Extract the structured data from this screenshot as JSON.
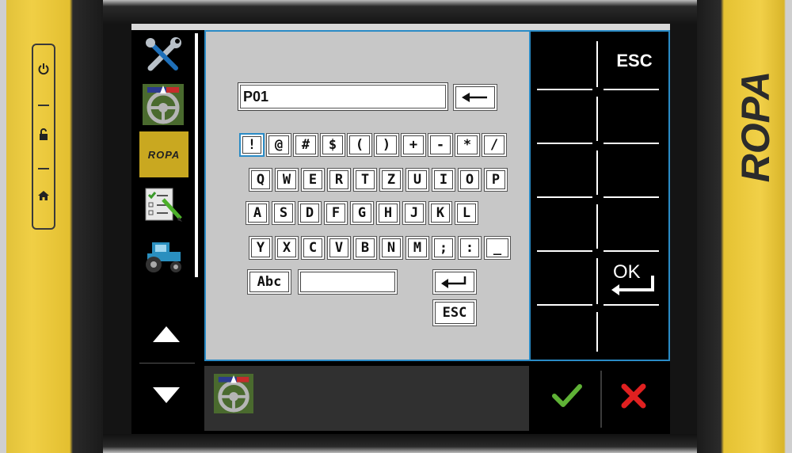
{
  "device": {
    "brand": "ROPA",
    "hw_buttons": [
      "power-icon",
      "unlock-icon",
      "home-icon"
    ]
  },
  "sidebar": {
    "items": [
      {
        "name": "tools-icon"
      },
      {
        "name": "steering-wheel-icon"
      },
      {
        "name": "ropa-logo-tile",
        "label": "ROPA"
      },
      {
        "name": "checklist-icon"
      },
      {
        "name": "tractor-icon"
      }
    ],
    "nav_up": "triangle-up-icon",
    "nav_down": "triangle-down-icon"
  },
  "input": {
    "value": "P01",
    "backspace_icon": "backspace-arrow-icon"
  },
  "keyboard": {
    "row1": [
      "!",
      "@",
      "#",
      "$",
      "(",
      ")",
      "+",
      "-",
      "*",
      "/"
    ],
    "row2": [
      "Q",
      "W",
      "E",
      "R",
      "T",
      "Z",
      "U",
      "I",
      "O",
      "P"
    ],
    "row3": [
      "A",
      "S",
      "D",
      "F",
      "G",
      "H",
      "J",
      "K",
      "L"
    ],
    "row4": [
      "Y",
      "X",
      "C",
      "V",
      "B",
      "N",
      "M",
      ";",
      ":",
      "_"
    ],
    "abc_label": "Abc",
    "space_label": "",
    "enter_icon": "enter-icon",
    "esc_label": "ESC"
  },
  "softkeys": {
    "esc_label": "ESC",
    "ok_label": "OK"
  },
  "statusbar": {
    "icon": "steering-wheel-icon",
    "confirm_icon": "checkmark-icon",
    "cancel_icon": "cross-icon"
  },
  "colors": {
    "accent": "#2a8bc6",
    "frame_yellow": "#f0cf45",
    "confirm": "#5fb236",
    "cancel": "#e02020"
  }
}
